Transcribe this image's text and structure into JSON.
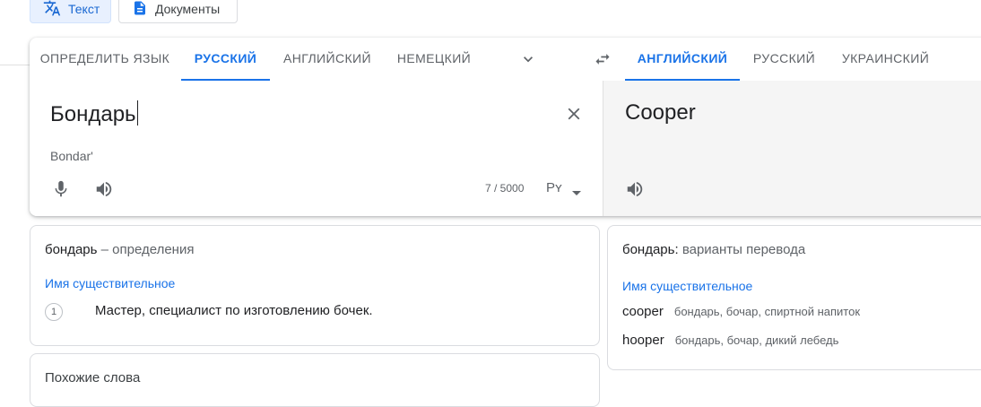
{
  "modes": {
    "text": "Текст",
    "docs": "Документы"
  },
  "source_langs": [
    "ОПРЕДЕЛИТЬ ЯЗЫК",
    "РУССКИЙ",
    "АНГЛИЙСКИЙ",
    "НЕМЕЦКИЙ"
  ],
  "target_langs": [
    "АНГЛИЙСКИЙ",
    "РУССКИЙ",
    "УКРАИНСКИЙ"
  ],
  "source": {
    "text": "Бондарь",
    "transliteration": "Bondar'",
    "char_count": "7 / 5000",
    "keyboard": "Рʏ"
  },
  "target": {
    "text": "Cooper"
  },
  "definitions": {
    "word": "бондарь",
    "suffix": "– определения",
    "pos": "Имя существительное",
    "items": [
      {
        "num": "1",
        "text": "Мастер, специалист по изготовлению бочек."
      }
    ]
  },
  "similar": {
    "title": "Похожие слова"
  },
  "alternatives": {
    "word": "бондарь:",
    "suffix": "варианты перевода",
    "pos": "Имя существительное",
    "rows": [
      {
        "word": "cooper",
        "back": "бондарь, бочар, спиртной напиток"
      },
      {
        "word": "hooper",
        "back": "бондарь, бочар, дикий лебедь"
      }
    ]
  },
  "colors": {
    "accent": "#1a73e8",
    "text": "#202124",
    "muted": "#5f6368",
    "target_bg": "#f5f5f5"
  }
}
